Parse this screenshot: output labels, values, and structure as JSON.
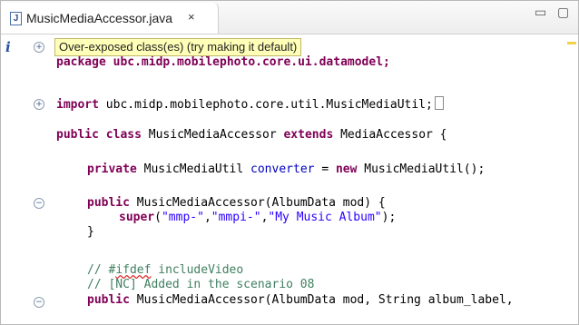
{
  "tab": {
    "title": "MusicMediaAccessor.java",
    "close_icon": "×",
    "file_icon": "J"
  },
  "window": {
    "minimize": "▭",
    "maximize": "▢"
  },
  "tooltip": {
    "text": "Over-exposed class(es) (try making it default)"
  },
  "code": {
    "package_line": "package ubc.midp.mobilephoto.core.ui.datamodel;",
    "import_keyword": "import",
    "import_rest": " ubc.midp.mobilephoto.core.util.MusicMediaUtil;",
    "class_kw_public": "public",
    "class_kw_class": "class",
    "class_name": "MusicMediaAccessor",
    "class_kw_extends": "extends",
    "class_super": "MediaAccessor {",
    "field_kw_private": "private",
    "field_type": "MusicMediaUtil",
    "field_name": "converter",
    "field_eq": "=",
    "field_kw_new": "new",
    "field_init": "MusicMediaUtil();",
    "ctor1_kw": "public",
    "ctor1_sig": "MusicMediaAccessor(AlbumData mod) {",
    "super_kw": "super",
    "super_arg1": "\"mmp-\"",
    "super_arg2": "\"mmpi-\"",
    "super_arg3": "\"My Music Album\"",
    "close_brace": "}",
    "comment1_prefix": "// #",
    "comment1_ifdef": "ifdef",
    "comment1_suffix": " includeVideo",
    "comment2": "// [NC] Added in the scenario 08",
    "ctor2_kw": "public",
    "ctor2_sig": "MusicMediaAccessor(AlbumData mod, String album_label,"
  },
  "colors": {
    "keyword": "#7f0055",
    "string": "#2a00ff",
    "field": "#0000c0",
    "comment": "#3f7f5f",
    "tooltip_bg": "#ffffb8"
  }
}
